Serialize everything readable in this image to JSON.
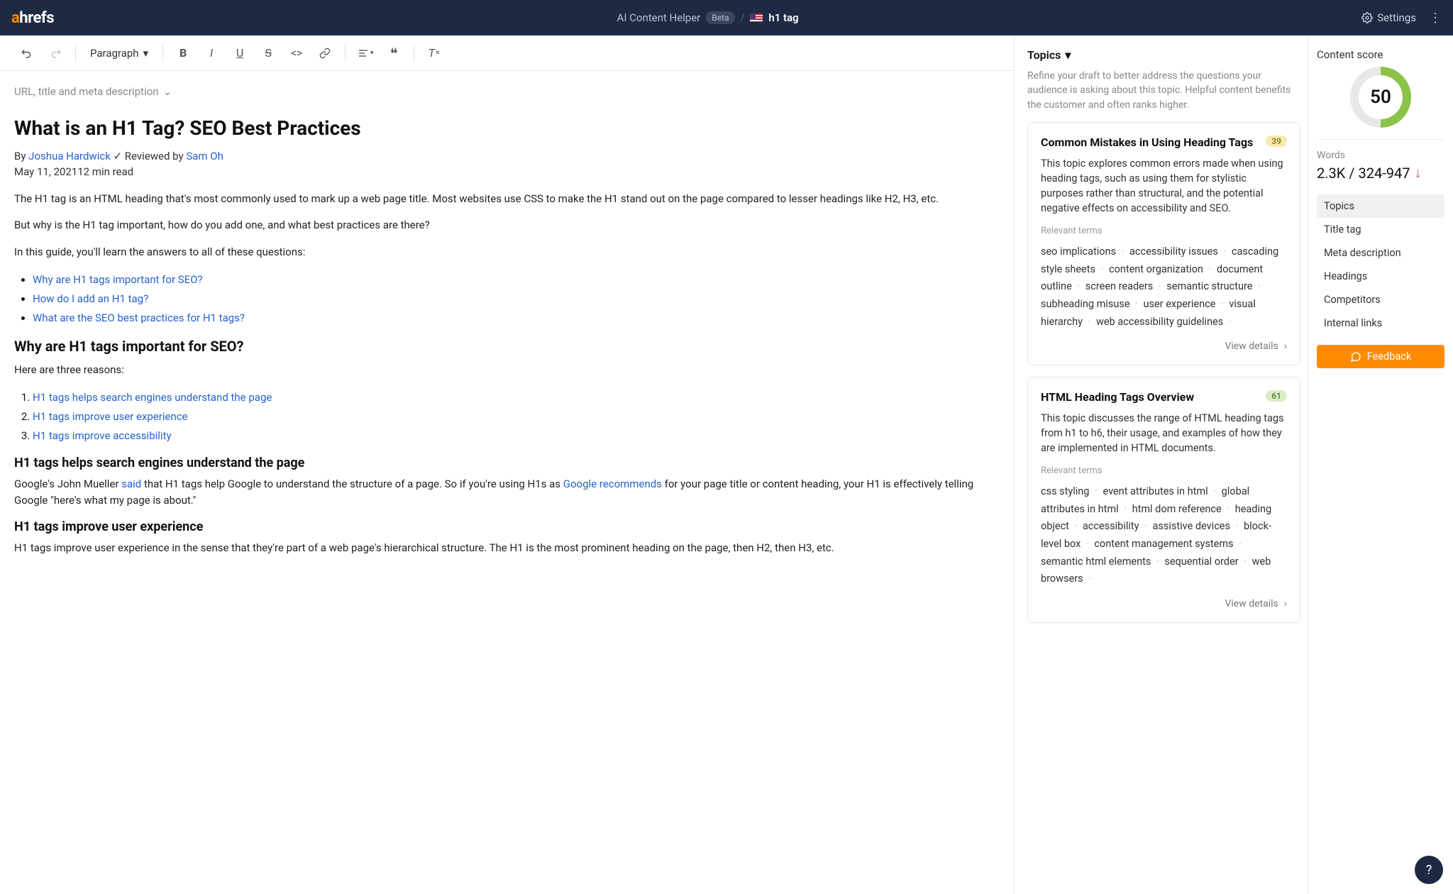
{
  "header": {
    "tool": "AI Content Helper",
    "beta": "Beta",
    "keyword": "h1 tag",
    "settings": "Settings"
  },
  "toolbar": {
    "paragraph": "Paragraph"
  },
  "meta_toggle": "URL, title and meta description",
  "article": {
    "title": "What is an H1 Tag? SEO Best Practices",
    "by_prefix": "By ",
    "author": "Joshua Hardwick",
    "reviewed_prefix": " ✓ Reviewed by ",
    "reviewer": "Sam Oh",
    "date": "May 11, 2021",
    "readtime": "12 min read",
    "p1": "The H1 tag is an HTML heading that's most commonly used to mark up a web page title. Most websites use CSS to make the H1 stand out on the page compared to lesser headings like H2, H3, etc.",
    "p2": "But why is the H1 tag important, how do you add one, and what best practices are there?",
    "p3": "In this guide, you'll learn the answers to all of these questions:",
    "toc": [
      "Why are H1 tags important for SEO?",
      "How do I add an H1 tag?",
      "What are the SEO best practices for H1 tags?"
    ],
    "h2_1": "Why are H1 tags important for SEO?",
    "p4": "Here are three reasons:",
    "reasons": [
      "H1 tags helps search engines understand the page",
      "H1 tags improve user experience",
      "H1 tags improve accessibility"
    ],
    "h3_1": "H1 tags helps search engines understand the page",
    "p5a": "Google's John Mueller ",
    "p5_link1": "said",
    "p5b": " that H1 tags help Google to understand the structure of a page. So if you're using H1s as ",
    "p5_link2": "Google recommends",
    "p5c": " for your page title or content heading, your H1 is effectively telling Google \"here's what my page is about.\"",
    "h3_2": "H1 tags improve user experience",
    "p6": "H1 tags improve user experience in the sense that they're part of a web page's hierarchical structure. The H1 is the most prominent heading on the page, then H2, then H3, etc."
  },
  "topics": {
    "header": "Topics",
    "desc": "Refine your draft to better address the questions your audience is asking about this topic. Helpful content benefits the customer and often ranks higher.",
    "rel_label": "Relevant terms",
    "view_details": "View details",
    "cards": [
      {
        "title": "Common Mistakes in Using Heading Tags",
        "badge": "39",
        "badge_class": "",
        "desc": "This topic explores common errors made when using heading tags, such as using them for stylistic purposes rather than structural, and the potential negative effects on accessibility and SEO.",
        "terms": [
          "seo implications",
          "accessibility issues",
          "cascading style sheets",
          "content organization",
          "document outline",
          "screen readers",
          "semantic structure",
          "subheading misuse",
          "user experience",
          "visual hierarchy",
          "web accessibility guidelines"
        ]
      },
      {
        "title": "HTML Heading Tags Overview",
        "badge": "61",
        "badge_class": "green",
        "desc": "This topic discusses the range of HTML heading tags from h1 to h6, their usage, and examples of how they are implemented in HTML documents.",
        "terms": [
          "css styling",
          "event attributes in html",
          "global attributes in html",
          "html dom reference",
          "heading object",
          "accessibility",
          "assistive devices",
          "block-level box",
          "content management systems",
          "semantic html elements",
          "sequential order",
          "web browsers"
        ]
      }
    ]
  },
  "score": {
    "label": "Content score",
    "value": "50",
    "words_label": "Words",
    "words_value": "2.3K / 324-947",
    "nav": [
      "Topics",
      "Title tag",
      "Meta description",
      "Headings",
      "Competitors",
      "Internal links"
    ],
    "feedback": "Feedback"
  },
  "help": "?"
}
